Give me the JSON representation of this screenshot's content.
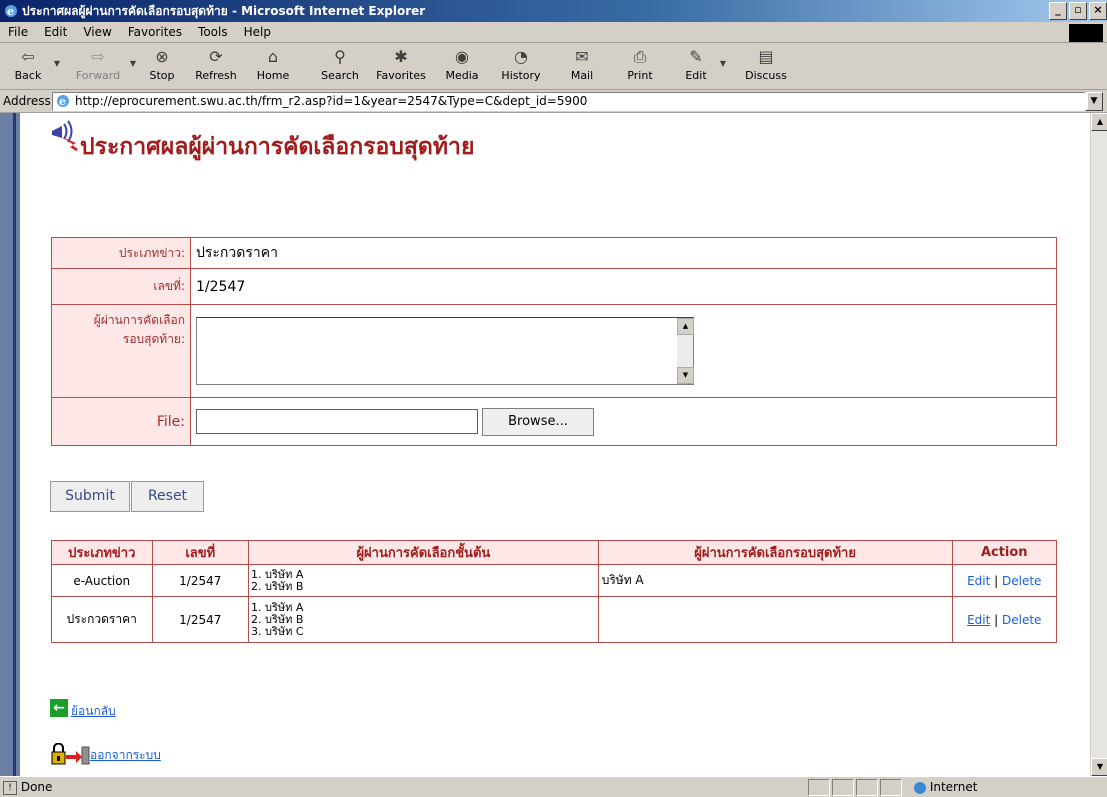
{
  "window": {
    "title": "ประกาศผลผู้ผ่านการคัดเลือกรอบสุดท้าย - Microsoft Internet Explorer"
  },
  "menu": [
    "File",
    "Edit",
    "View",
    "Favorites",
    "Tools",
    "Help"
  ],
  "toolbar": [
    {
      "label": "Back",
      "icon": "back-icon"
    },
    {
      "label": "Forward",
      "icon": "forward-icon"
    },
    {
      "label": "Stop",
      "icon": "stop-icon"
    },
    {
      "label": "Refresh",
      "icon": "refresh-icon"
    },
    {
      "label": "Home",
      "icon": "home-icon"
    },
    {
      "label": "Search",
      "icon": "search-icon"
    },
    {
      "label": "Favorites",
      "icon": "favorites-icon"
    },
    {
      "label": "Media",
      "icon": "media-icon"
    },
    {
      "label": "History",
      "icon": "history-icon"
    },
    {
      "label": "Mail",
      "icon": "mail-icon"
    },
    {
      "label": "Print",
      "icon": "print-icon"
    },
    {
      "label": "Edit",
      "icon": "edit-icon"
    },
    {
      "label": "Discuss",
      "icon": "discuss-icon"
    }
  ],
  "address": {
    "label": "Address",
    "url": "http://eprocurement.swu.ac.th/frm_r2.asp?id=1&year=2547&Type=C&dept_id=5900"
  },
  "page": {
    "heading": "ประกาศผลผู้ผ่านการคัดเลือกรอบสุดท้าย",
    "form": {
      "type_label": "ประเภทข่าว:",
      "type_value": "ประกวดราคา",
      "number_label": "เลขที่:",
      "number_value": "1/2547",
      "final_label_1": "ผู้ผ่านการคัดเลือก",
      "final_label_2": "รอบสุดท้าย:",
      "file_label": "File:",
      "browse_label": "Browse..."
    },
    "buttons": {
      "submit": "Submit",
      "reset": "Reset"
    },
    "table": {
      "headers": [
        "ประเภทข่าว",
        "เลขที่",
        "ผู้ผ่านการคัดเลือกชั้นต้น",
        "ผู้ผ่านการคัดเลือกรอบสุดท้าย",
        "Action"
      ],
      "rows": [
        {
          "type": "e-Auction",
          "number": "1/2547",
          "initial": [
            "1. บริษัท A",
            "2. บริษัท B"
          ],
          "final": "บริษัท A",
          "edit": "Edit",
          "sep": "|",
          "delete": "Delete"
        },
        {
          "type": "ประกวดราคา",
          "number": "1/2547",
          "initial": [
            "1. บริษัท A",
            "2. บริษัท B",
            "3. บริษัท C"
          ],
          "final": "",
          "edit": "Edit",
          "sep": "|",
          "delete": "Delete"
        }
      ]
    },
    "back_link": "ย้อนกลับ",
    "logout_link": "ออกจากระบบ"
  },
  "status": {
    "text": "Done",
    "zone": "Internet"
  }
}
